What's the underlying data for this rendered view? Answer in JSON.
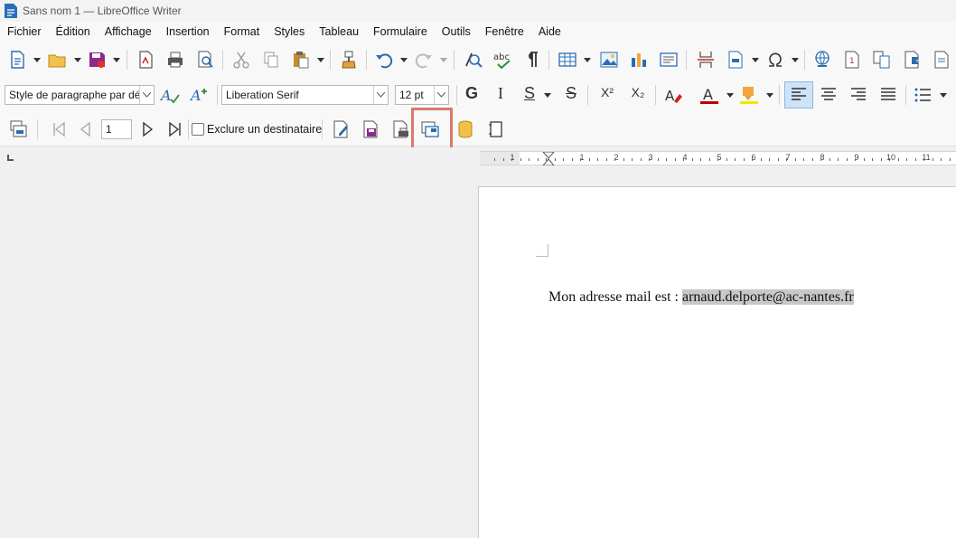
{
  "window": {
    "title": "Sans nom 1 — LibreOffice Writer"
  },
  "menu": [
    "Fichier",
    "Édition",
    "Affichage",
    "Insertion",
    "Format",
    "Styles",
    "Tableau",
    "Formulaire",
    "Outils",
    "Fenêtre",
    "Aide"
  ],
  "format_bar": {
    "paragraph_style": "Style de paragraphe par défaut",
    "font_name": "Liberation Serif",
    "font_size": "12 pt",
    "bold": "G",
    "italic": "I",
    "underline": "S",
    "strike": "S",
    "superscript": "X²",
    "subscript": "X₂"
  },
  "mailmerge_bar": {
    "record_number": "1",
    "exclude_label": "Exclure un destinataire"
  },
  "colors": {
    "accent": "#2b6cb0",
    "highlight": "#d97a6c",
    "font_color": "#c00000",
    "highlight_color": "#f5e400"
  },
  "ruler": {
    "labels": [
      "1",
      "1",
      "2",
      "3",
      "4",
      "5",
      "6",
      "7",
      "8",
      "9",
      "10",
      "11"
    ]
  },
  "document": {
    "text_before": "Mon adresse mail est : ",
    "field_value": "arnaud.delporte@ac-nantes.fr"
  }
}
